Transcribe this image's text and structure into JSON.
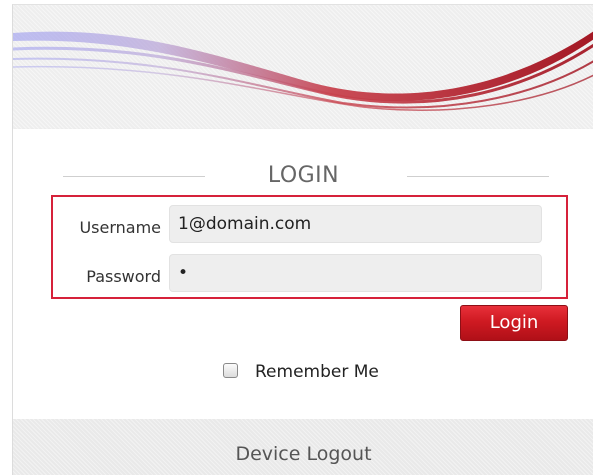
{
  "login": {
    "title": "LOGIN",
    "username_label": "Username",
    "username_value": "1@domain.com",
    "password_label": "Password",
    "password_value": "•",
    "login_button": "Login",
    "remember_label": "Remember Me",
    "remember_checked": false
  },
  "footer": {
    "device_logout": "Device Logout"
  },
  "colors": {
    "accent": "#d6213a",
    "button": "#cf1a22",
    "swoosh_dark": "#a00d1a",
    "swoosh_light": "#8f8ff0"
  }
}
